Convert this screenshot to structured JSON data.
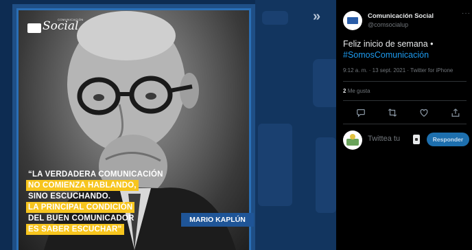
{
  "poster": {
    "logo_word": "Social",
    "logo_small": "COMUNICACIÓN",
    "quote_lines": [
      {
        "text": "“LA VERDADERA COMUNICACIÓN",
        "hl": false
      },
      {
        "text": "NO COMIENZA HABLANDO,",
        "hl": true
      },
      {
        "text": "SINO ESCUCHANDO.",
        "hl": false
      },
      {
        "text": "LA PRINCIPAL CONDICIÓN",
        "hl": true
      },
      {
        "text": "DEL BUEN COMUNICADOR",
        "hl": false
      },
      {
        "text": "ES SABER ESCUCHAR”",
        "hl": true
      }
    ],
    "author": "MARIO KAPLÚN"
  },
  "nav": {
    "collapse_icon": "»"
  },
  "tweet": {
    "user_name": "Comunicación Social",
    "user_handle": "@comsocialup",
    "more": "···",
    "text_plain": "Feliz inicio de semana •",
    "hashtag": "#SomosComunicación",
    "meta": "9:12 a. m. · 13 sept. 2021 · Twitter for iPhone",
    "likes_count": "2",
    "likes_label": "Me gusta"
  },
  "reply": {
    "placeholder": "Twittea tu",
    "button": "Responder"
  },
  "colors": {
    "accent": "#1d9bf0",
    "highlight": "#f7c51e",
    "poster_blue": "#1f5597",
    "panel_bg": "#000000"
  }
}
